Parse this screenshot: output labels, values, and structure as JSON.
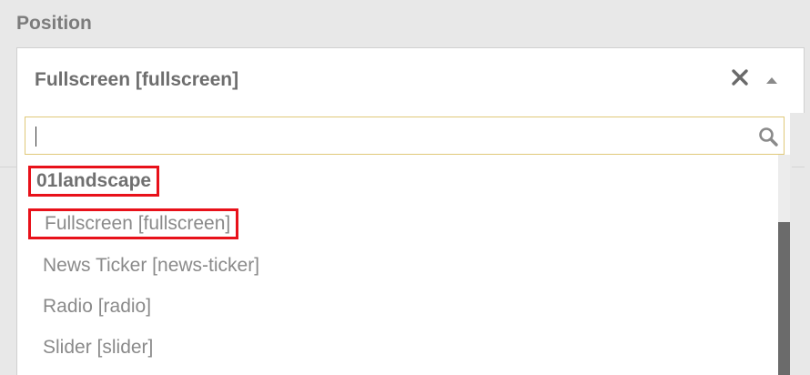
{
  "field": {
    "label": "Position",
    "selected_value": "Fullscreen [fullscreen]"
  },
  "icons": {
    "clear": "close-icon",
    "arrow": "caret-up-icon",
    "search": "search-icon"
  },
  "dropdown": {
    "search": {
      "value": "",
      "placeholder": ""
    },
    "group_label": "01landscape",
    "options": [
      {
        "label": "Fullscreen [fullscreen]",
        "highlighted": true
      },
      {
        "label": "News Ticker [news-ticker]",
        "highlighted": false
      },
      {
        "label": "Radio [radio]",
        "highlighted": false
      },
      {
        "label": "Slider [slider]",
        "highlighted": false
      }
    ]
  },
  "colors": {
    "highlight_border": "#e8111a",
    "search_border": "#e0c97a",
    "scroll_thumb": "#6b6b6b"
  }
}
